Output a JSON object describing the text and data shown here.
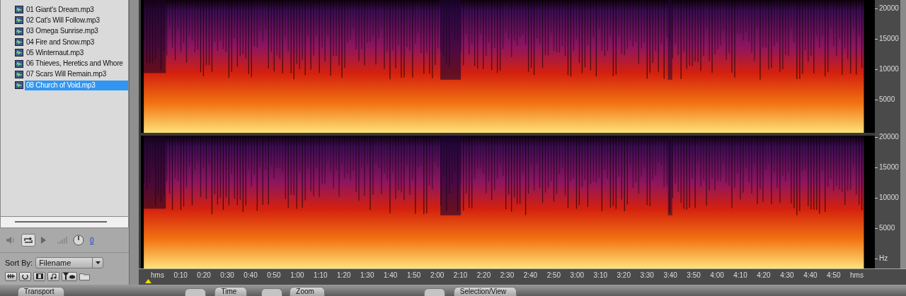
{
  "file_list": {
    "items": [
      {
        "name": "01 Giant's Dream.mp3",
        "selected": false
      },
      {
        "name": "02 Cat's Will Follow.mp3",
        "selected": false
      },
      {
        "name": "03 Omega Sunrise.mp3",
        "selected": false
      },
      {
        "name": "04 Fire and Snow.mp3",
        "selected": false
      },
      {
        "name": "05 Winternaut.mp3",
        "selected": false
      },
      {
        "name": "06 Thieves, Heretics and Whore",
        "selected": false
      },
      {
        "name": "07 Scars Will Remain.mp3",
        "selected": false
      },
      {
        "name": "08 Church of Void.mp3",
        "selected": true
      }
    ]
  },
  "playback": {
    "volume_value": "0"
  },
  "sort": {
    "label": "Sort By:",
    "value": "Filename"
  },
  "spectrogram": {
    "channels": [
      {
        "frequency_labels": [
          "20000",
          "15000",
          "10000",
          "5000"
        ]
      },
      {
        "frequency_labels": [
          "20000",
          "15000",
          "10000",
          "5000"
        ]
      }
    ],
    "frequency_unit": "Hz",
    "time_unit_start": "hms",
    "time_unit_end": "hms",
    "time_labels": [
      "0:10",
      "0:20",
      "0:30",
      "0:40",
      "0:50",
      "1:00",
      "1:10",
      "1:20",
      "1:30",
      "1:40",
      "1:50",
      "2:00",
      "2:10",
      "2:20",
      "2:30",
      "2:40",
      "2:50",
      "3:00",
      "3:10",
      "3:20",
      "3:30",
      "3:40",
      "3:50",
      "4:00",
      "4:10",
      "4:20",
      "4:30",
      "4:40",
      "4:50"
    ]
  },
  "panels": [
    {
      "label": "Transport"
    },
    {
      "label": "Time"
    },
    {
      "label": "Zoom"
    },
    {
      "label": "Selection/View"
    }
  ]
}
